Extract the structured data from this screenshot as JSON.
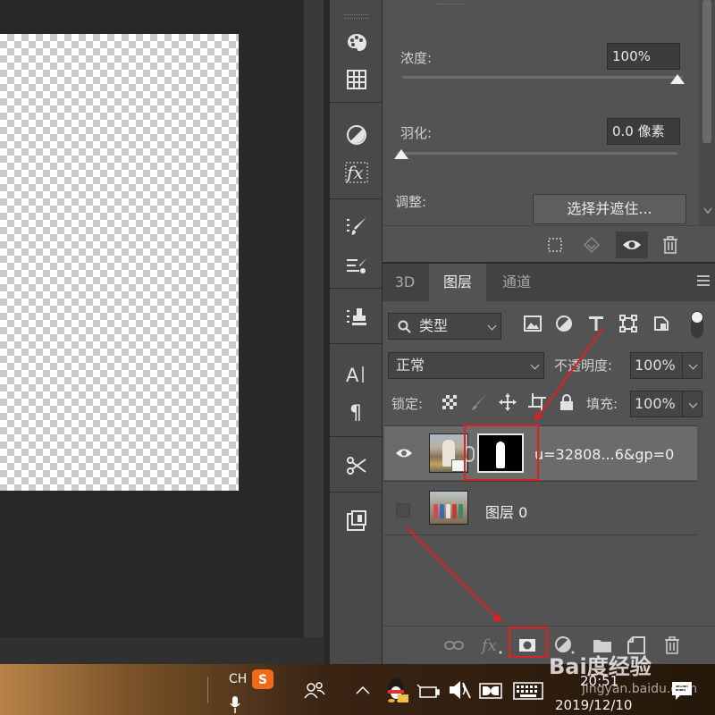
{
  "properties": {
    "density_label": "浓度:",
    "density_value": "100%",
    "feather_label": "羽化:",
    "feather_value": "0.0 像素",
    "adjust_label": "调整:",
    "refine_button": "选择并遮住..."
  },
  "layers_panel": {
    "tabs": [
      {
        "label": "3D",
        "active": false
      },
      {
        "label": "图层",
        "active": true
      },
      {
        "label": "通道",
        "active": false
      }
    ],
    "filter_kind": "类型",
    "blend_mode": "正常",
    "opacity_label": "不透明度:",
    "opacity_value": "100%",
    "lock_label": "锁定:",
    "fill_label": "填充:",
    "fill_value": "100%",
    "layers": [
      {
        "name": "u=32808...6&gp=0",
        "visible": true,
        "selected": true,
        "has_mask": true
      },
      {
        "name": "图层 0",
        "visible": false,
        "selected": false,
        "has_mask": false
      }
    ]
  },
  "taskbar": {
    "ime": "CH",
    "time": "20:51",
    "date": "2019/12/10"
  },
  "watermark": {
    "brand": "Bai度经验",
    "url": "jingyan.baidu.com"
  },
  "colors": {
    "highlight_red": "#e02020",
    "panel_bg": "#535353",
    "canvas_bg": "#282828"
  }
}
